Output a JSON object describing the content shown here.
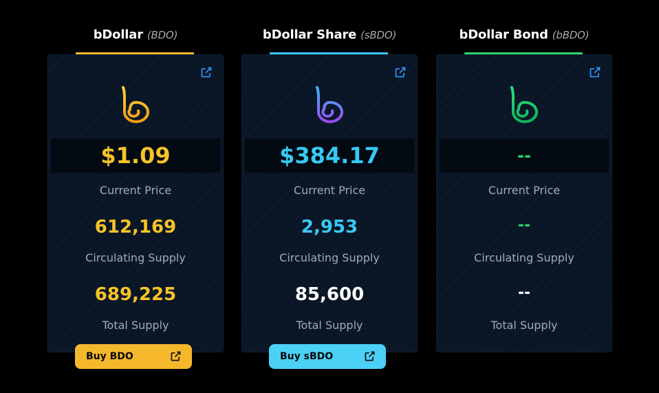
{
  "colors": {
    "bdo": "#f7c327",
    "sbdo": "#38c8f4",
    "bbdo": "#2bd46a",
    "bdo_button": "#f5b72c",
    "sbdo_button": "#4cd0f6",
    "label": "#a3abb8",
    "white": "#ffffff"
  },
  "tokens": [
    {
      "name": "bDollar",
      "ticker": "(BDO)",
      "logo_icon": "bdollar-logo-icon",
      "price": "$1.09",
      "price_label": "Current Price",
      "circulating_supply": "612,169",
      "circulating_label": "Circulating Supply",
      "total_supply": "689,225",
      "total_label": "Total Supply",
      "buy_label": "Buy BDO"
    },
    {
      "name": "bDollar Share",
      "ticker": "(sBDO)",
      "logo_icon": "bdollar-share-logo-icon",
      "price": "$384.17",
      "price_label": "Current Price",
      "circulating_supply": "2,953",
      "circulating_label": "Circulating Supply",
      "total_supply": "85,600",
      "total_label": "Total Supply",
      "buy_label": "Buy sBDO"
    },
    {
      "name": "bDollar Bond",
      "ticker": "(bBDO)",
      "logo_icon": "bdollar-bond-logo-icon",
      "price": "--",
      "price_label": "Current Price",
      "circulating_supply": "--",
      "circulating_label": "Circulating Supply",
      "total_supply": "--",
      "total_label": "Total Supply"
    }
  ]
}
